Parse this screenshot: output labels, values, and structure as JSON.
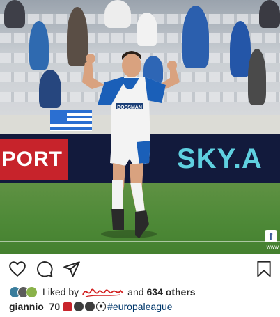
{
  "photo": {
    "board_left_text": "PORT",
    "board_right_text": "SKY.A",
    "jersey_sponsor": "BOSSMAN",
    "watermark": "f",
    "watermark_sub": "www"
  },
  "actions": {
    "like_icon": "heart-icon",
    "comment_icon": "comment-icon",
    "share_icon": "send-icon",
    "save_icon": "bookmark-icon"
  },
  "likes": {
    "prefix": "Liked by",
    "connector": "and",
    "others": "634 others"
  },
  "caption": {
    "username": "giannio_70",
    "hashtag": "#europaleague"
  }
}
